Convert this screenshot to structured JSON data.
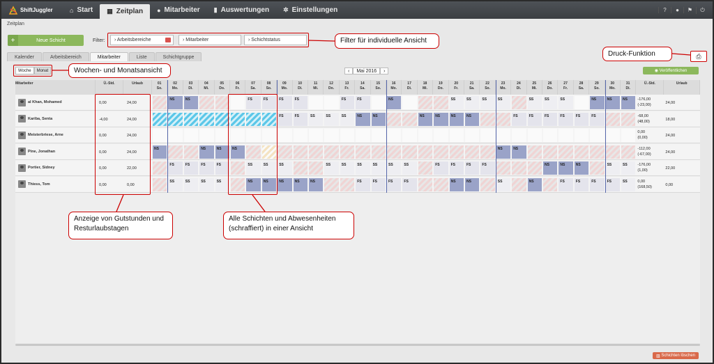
{
  "app": {
    "logo": "ShiftJuggler"
  },
  "nav": [
    {
      "label": "Start",
      "icon": "home-icon",
      "glyph": "⌂"
    },
    {
      "label": "Zeitplan",
      "icon": "calendar-icon",
      "glyph": "▦"
    },
    {
      "label": "Mitarbeiter",
      "icon": "user-icon",
      "glyph": "●"
    },
    {
      "label": "Auswertungen",
      "icon": "chart-icon",
      "glyph": "▮"
    },
    {
      "label": "Einstellungen",
      "icon": "gear-icon",
      "glyph": "✲"
    }
  ],
  "breadcrumb": "Zeitplan",
  "toolbar": {
    "new_shift": "Neue Schicht",
    "filter_label": "Filter:",
    "filters": [
      "Arbeitsbereiche",
      "Mitarbeiter",
      "Schichtstatus"
    ]
  },
  "view_tabs": [
    "Kalender",
    "Arbeitsbereich",
    "Mitarbeiter",
    "Liste",
    "Schichtgruppe"
  ],
  "period": {
    "week": "Woche",
    "month": "Monat",
    "current": "Mai 2016",
    "prev": "‹",
    "next": "›"
  },
  "publish_label": "Veröffentlichen",
  "columns": {
    "name": "Mitarbeiter",
    "hours": "Ü.-Std.",
    "vacation": "Urlaub",
    "hours2": "Ü.-Std.",
    "vacation2": "Urlaub"
  },
  "days": [
    [
      "01",
      "So."
    ],
    [
      "02",
      "Mo."
    ],
    [
      "03",
      "Di."
    ],
    [
      "04",
      "Mi."
    ],
    [
      "05",
      "Do."
    ],
    [
      "06",
      "Fr."
    ],
    [
      "07",
      "Sa."
    ],
    [
      "08",
      "So."
    ],
    [
      "09",
      "Mo."
    ],
    [
      "10",
      "Di."
    ],
    [
      "11",
      "Mi."
    ],
    [
      "12",
      "Do."
    ],
    [
      "13",
      "Fr."
    ],
    [
      "14",
      "Sa."
    ],
    [
      "15",
      "So."
    ],
    [
      "16",
      "Mo."
    ],
    [
      "17",
      "Di."
    ],
    [
      "18",
      "Mi."
    ],
    [
      "19",
      "Do."
    ],
    [
      "20",
      "Fr."
    ],
    [
      "21",
      "Sa."
    ],
    [
      "22",
      "So."
    ],
    [
      "23",
      "Mo."
    ],
    [
      "24",
      "Di."
    ],
    [
      "25",
      "Mi."
    ],
    [
      "26",
      "Do."
    ],
    [
      "27",
      "Fr."
    ],
    [
      "28",
      "Sa."
    ],
    [
      "29",
      "So."
    ],
    [
      "30",
      "Mo."
    ],
    [
      "31",
      "Di."
    ]
  ],
  "employees": [
    {
      "name": "al Khan, Mohamed",
      "hours": "0,00",
      "vacation": "24,00",
      "hours2": "-176,00",
      "hours2b": "(-23,00)",
      "vacation2": "24,00",
      "cells": [
        "h",
        "NS",
        "NS",
        "h",
        "h",
        "w",
        "FS",
        "FS",
        "FS",
        "FS",
        "w",
        "w",
        "FS",
        "FS",
        "w",
        "NS",
        "w",
        "h",
        "h",
        "SS",
        "SS",
        "SS",
        "SS",
        "h",
        "SS",
        "SS",
        "SS",
        "w",
        "NS",
        "NS",
        "NS"
      ]
    },
    {
      "name": "Kariba, Senta",
      "hours": "-4,00",
      "vacation": "24,00",
      "hours2": "-68,00",
      "hours2b": "(48,00)",
      "vacation2": "18,00",
      "cells": [
        "b",
        "b",
        "b",
        "b",
        "b",
        "b",
        "b",
        "b",
        "FS",
        "FS",
        "SS",
        "SS",
        "SS",
        "NS",
        "NS",
        "h",
        "h",
        "NS",
        "NS",
        "NS",
        "NS",
        "h",
        "h",
        "FS",
        "FS",
        "FS",
        "FS",
        "FS",
        "FS",
        "h",
        "h"
      ]
    },
    {
      "name": "Meisterbriese, Arne",
      "hours": "0,00",
      "vacation": "24,00",
      "hours2": "0,00",
      "hours2b": "(0,00)",
      "vacation2": "24,00",
      "cells": [
        "w",
        "w",
        "w",
        "w",
        "w",
        "w",
        "w",
        "w",
        "w",
        "w",
        "w",
        "w",
        "w",
        "w",
        "w",
        "w",
        "w",
        "w",
        "w",
        "w",
        "w",
        "w",
        "w",
        "w",
        "w",
        "w",
        "w",
        "w",
        "w",
        "w",
        "w"
      ]
    },
    {
      "name": "Pine, Jonathan",
      "hours": "0,00",
      "vacation": "24,00",
      "hours2": "-112,00",
      "hours2b": "(-67,00)",
      "vacation2": "24,00",
      "cells": [
        "NS",
        "h",
        "h",
        "NS",
        "NS",
        "NS",
        "h",
        "y",
        "h",
        "h",
        "h",
        "h",
        "h",
        "h",
        "h",
        "h",
        "h",
        "h",
        "h",
        "h",
        "h",
        "h",
        "NS",
        "NS",
        "h",
        "h",
        "h",
        "h",
        "h",
        "h",
        "h"
      ]
    },
    {
      "name": "Portier, Sidney",
      "hours": "0,00",
      "vacation": "22,00",
      "hours2": "-176,00",
      "hours2b": "(1,00)",
      "vacation2": "22,00",
      "cells": [
        "h",
        "FS",
        "FS",
        "FS",
        "FS",
        "h",
        "SS",
        "SS",
        "SS",
        "h",
        "h",
        "SS",
        "SS",
        "SS",
        "SS",
        "SS",
        "SS",
        "h",
        "FS",
        "FS",
        "FS",
        "FS",
        "h",
        "h",
        "h",
        "NS",
        "NS",
        "NS",
        "h",
        "SS",
        "SS"
      ]
    },
    {
      "name": "Thiess, Tom",
      "hours": "0,00",
      "vacation": "0,00",
      "hours2": "0,00",
      "hours2b": "(168,50)",
      "vacation2": "0,00",
      "cells": [
        "h",
        "SS",
        "SS",
        "SS",
        "SS",
        "h",
        "NS",
        "NS",
        "NS",
        "NS",
        "NS",
        "h",
        "h",
        "FS",
        "FS",
        "FS",
        "FS",
        "h",
        "h",
        "NS",
        "NS",
        "h",
        "SS",
        "h",
        "NS",
        "h",
        "FS",
        "FS",
        "FS",
        "FS",
        "SS"
      ]
    }
  ],
  "annotations": {
    "filter": "Filter für individuelle Ansicht",
    "print": "Druck-Funktion",
    "weekmonth": "Wochen- und Monatsansicht",
    "hours": "Anzeige von Gutstunden und Resturlaubstagen",
    "shifts": "Alle Schichten und Abwesenheiten (schraffiert) in einer Ansicht"
  },
  "delete_label": "Schichten löschen"
}
